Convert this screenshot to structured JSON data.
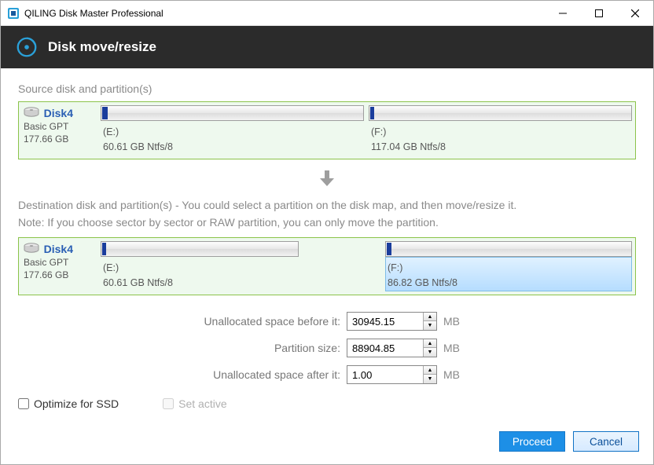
{
  "titlebar": {
    "title": "QILING Disk Master Professional"
  },
  "header": {
    "title": "Disk move/resize"
  },
  "source": {
    "label": "Source disk and partition(s)",
    "disk": {
      "name": "Disk4",
      "meta": "Basic GPT\n177.66 GB"
    },
    "parts": [
      {
        "letter": "(E:)",
        "desc": "60.61 GB Ntfs/8",
        "fill_pct": 2
      },
      {
        "letter": "(F:)",
        "desc": "117.04 GB Ntfs/8",
        "fill_pct": 1.5
      }
    ]
  },
  "dest": {
    "label": "Destination disk and partition(s) - You could select a partition on the disk map, and then move/resize it.",
    "note": "Note: If you choose sector by sector or RAW partition, you can only move the partition.",
    "disk": {
      "name": "Disk4",
      "meta": "Basic GPT\n177.66 GB"
    },
    "parts": {
      "p1": {
        "letter": "(E:)",
        "desc": "60.61 GB Ntfs/8",
        "fill_pct": 2
      },
      "p2": {
        "letter": "(F:)",
        "desc": "86.82 GB Ntfs/8",
        "fill_pct": 2
      }
    }
  },
  "form": {
    "before_label": "Unallocated space before it:",
    "before_value": "30945.15",
    "size_label": "Partition size:",
    "size_value": "88904.85",
    "after_label": "Unallocated space after it:",
    "after_value": "1.00",
    "unit": "MB"
  },
  "checks": {
    "ssd": "Optimize for SSD",
    "active": "Set active"
  },
  "footer": {
    "proceed": "Proceed",
    "cancel": "Cancel"
  }
}
